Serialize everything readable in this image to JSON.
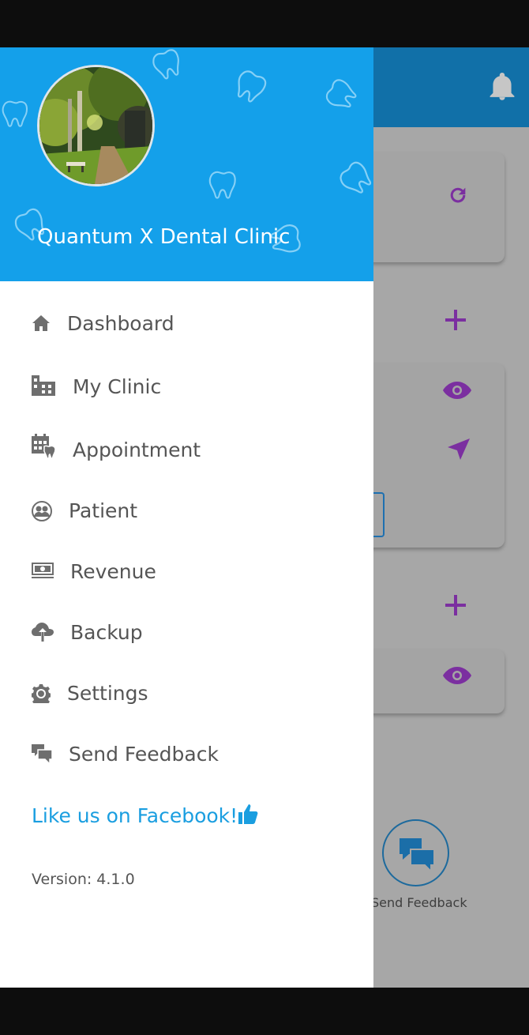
{
  "drawer": {
    "clinic_name": "Quantum X Dental Clinic",
    "header_color": "#14a0ea",
    "menu": [
      {
        "label": "Dashboard",
        "icon": "home-icon"
      },
      {
        "label": "My Clinic",
        "icon": "clinic-building-icon"
      },
      {
        "label": "Appointment",
        "icon": "calendar-tooth-icon"
      },
      {
        "label": "Patient",
        "icon": "patient-group-icon"
      },
      {
        "label": "Revenue",
        "icon": "cash-icon"
      },
      {
        "label": "Backup",
        "icon": "cloud-upload-icon"
      },
      {
        "label": "Settings",
        "icon": "gear-icon"
      },
      {
        "label": "Send Feedback",
        "icon": "chat-bubbles-icon"
      }
    ],
    "facebook_link": "Like us on Facebook!",
    "facebook_icon": "thumbs-up-icon",
    "version": "Version: 4.1.0"
  },
  "background": {
    "feedback_label": "Send Feedback",
    "accent_color": "#7b2fa0",
    "header_color": "#1170a8"
  }
}
